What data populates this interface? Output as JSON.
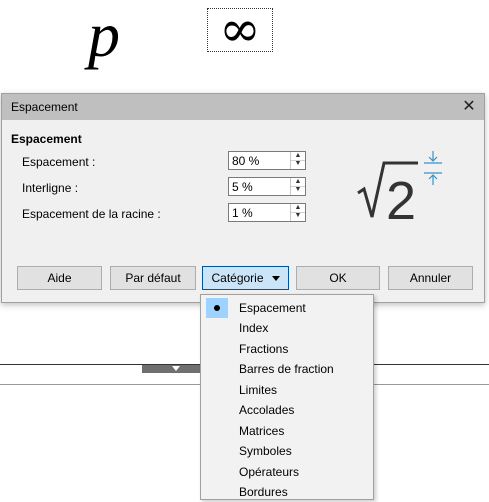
{
  "background": {
    "symbol_p": "p",
    "symbol_infinity": "∞"
  },
  "dialog": {
    "title": "Espacement",
    "section_title": "Espacement",
    "fields": [
      {
        "label": "Espacement :",
        "value": "80 %"
      },
      {
        "label": "Interligne :",
        "value": "5 %"
      },
      {
        "label": "Espacement de la racine :",
        "value": "1 %"
      }
    ],
    "preview_icon": "root-spacing-preview-icon",
    "buttons": {
      "help": "Aide",
      "default": "Par défaut",
      "category": "Catégorie",
      "ok": "OK",
      "cancel": "Annuler"
    }
  },
  "category_menu": {
    "items": [
      {
        "label": "Espacement",
        "checked": true
      },
      {
        "label": "Index",
        "checked": false
      },
      {
        "label": "Fractions",
        "checked": false
      },
      {
        "label": "Barres de fraction",
        "checked": false
      },
      {
        "label": "Limites",
        "checked": false
      },
      {
        "label": "Accolades",
        "checked": false
      },
      {
        "label": "Matrices",
        "checked": false
      },
      {
        "label": "Symboles",
        "checked": false
      },
      {
        "label": "Opérateurs",
        "checked": false
      },
      {
        "label": "Bordures",
        "checked": false
      }
    ]
  },
  "colors": {
    "accent": "#0078d7",
    "checked_highlight": "#9ed3ff",
    "preview_arrows": "#3a8fc4"
  }
}
